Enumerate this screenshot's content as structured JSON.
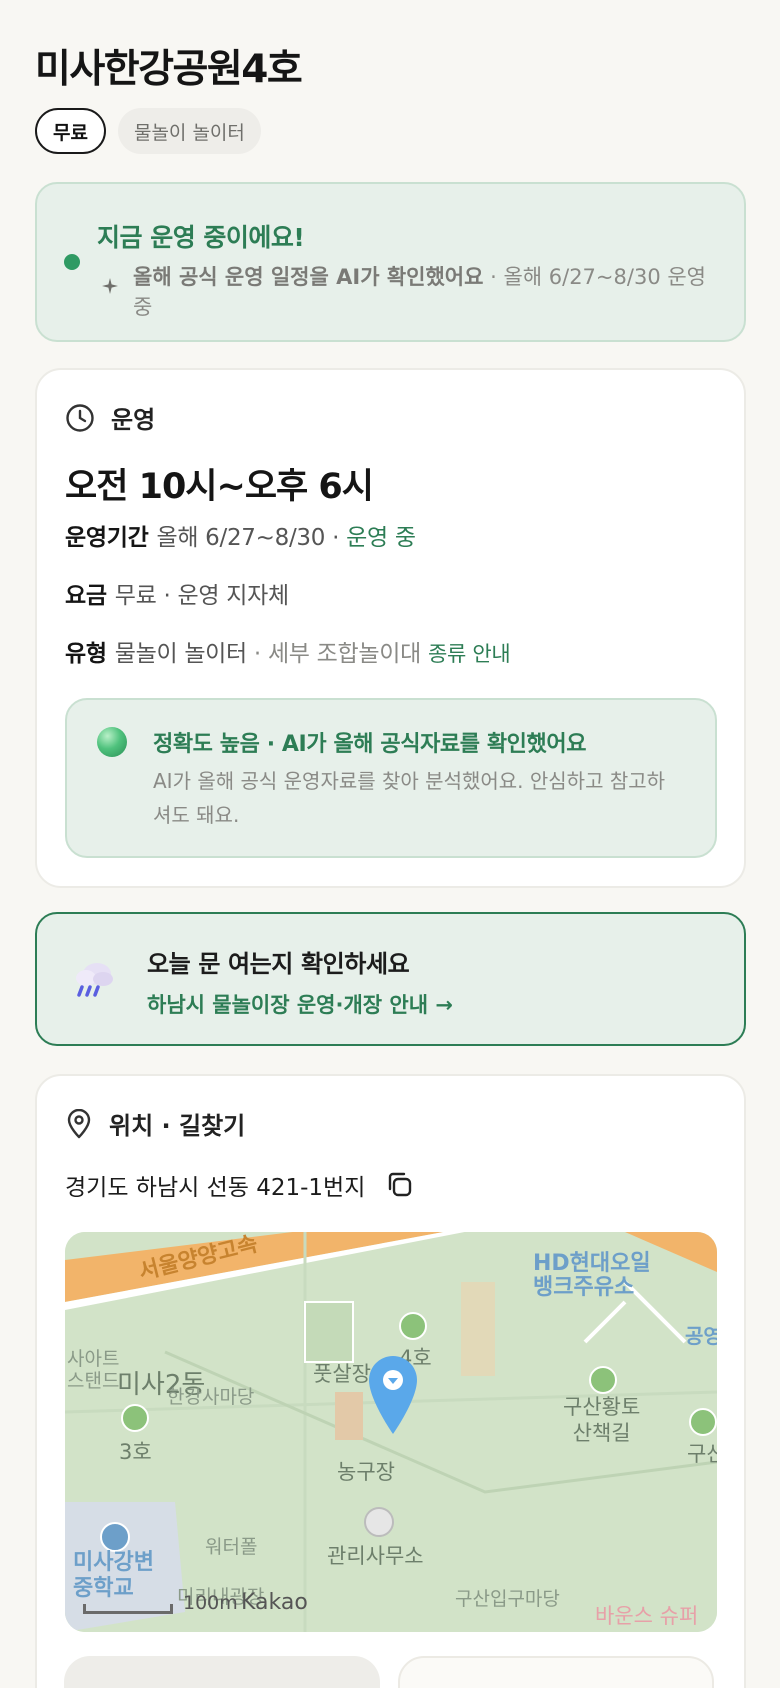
{
  "header": {
    "title": "미사한강공원4호"
  },
  "tags": [
    {
      "label": "무료"
    },
    {
      "label": "물놀이 놀이터"
    }
  ],
  "status": {
    "title": "지금 운영 중이에요!",
    "sub_bold": "올해 공식 운영 일정을 AI가 확인했어요",
    "sub_rest": " · 올해 6/27~8/30 운영 중"
  },
  "operation": {
    "section_label": "운영",
    "hours": "오전 10시~오후 6시",
    "period_key": "운영기간",
    "period_value": "올해 6/27~8/30 · ",
    "period_status": "운영 중",
    "fee_key": "요금",
    "fee_value": "무료 · 운영 지자체",
    "type_key": "유형",
    "type_value": "물놀이 놀이터",
    "type_detail": " · 세부 조합놀이대 ",
    "type_link": "종류 안내",
    "accuracy_title": "정확도 높음 · AI가 올해 공식자료를 확인했어요",
    "accuracy_body": "AI가 올해 공식 운영자료를 찾아 분석했어요. 안심하고 참고하셔도 돼요."
  },
  "alert": {
    "title": "오늘 문 여는지 확인하세요",
    "link": "하남시 물놀이장 운영·개장 안내 →"
  },
  "location": {
    "section_label": "위치 · 길찾기",
    "address": "경기도 하남시 선동 421-1번지",
    "map_labels": {
      "road": "서울양양고속",
      "station": "HD현대오일뱅크주유소",
      "station_line1": "HD현대오일",
      "station_line2": "뱅크주유소",
      "parking": "공영",
      "site": "사아트",
      "site2": "스탠드",
      "misa2": "미사2동",
      "madang": "한강사마당",
      "area3": "3호",
      "area4": "4호",
      "grass": "풋살장",
      "court": "농구장",
      "trail1": "구산황토",
      "trail2": "산책길",
      "gusan": "구산",
      "office": "관리사무소",
      "waterpool": "워터폴",
      "school1": "미사강변",
      "school2": "중학교",
      "plaza": "미리내광장",
      "entrance": "구산입구마당",
      "bounce": "바운스 슈퍼",
      "scale": "100m",
      "brand": "Kakao"
    }
  },
  "colors": {
    "accent": "#2d7d55",
    "accent_bg": "#e7f0ea",
    "background": "#f8f7f3"
  }
}
